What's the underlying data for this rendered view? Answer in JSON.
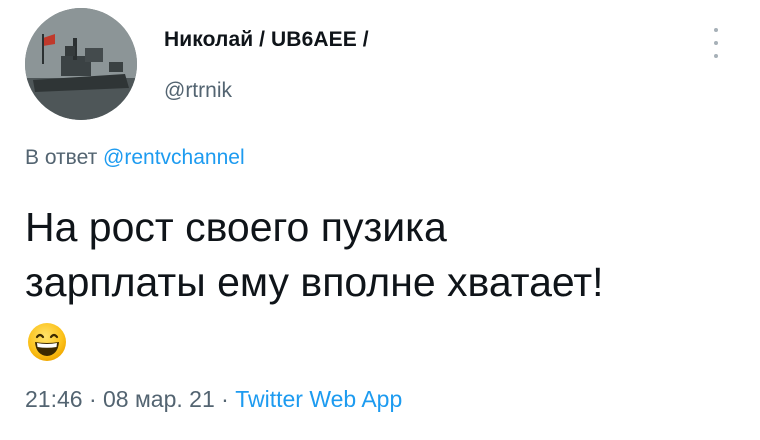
{
  "author": {
    "display_name": "Николай  / UB6AEE /",
    "handle": "@rtrnik"
  },
  "reply": {
    "prefix": "В ответ",
    "mention": "@rentvchannel"
  },
  "tweet": {
    "lines": [
      "На рост своего пузика",
      "зарплаты ему вполне хватает!"
    ],
    "emoji": "grinning-face-with-smiling-eyes"
  },
  "meta": {
    "time": "21:46",
    "date": "08 мар. 21",
    "separator": "·",
    "source": "Twitter Web App"
  },
  "colors": {
    "text": "#0f1419",
    "secondary": "#536471",
    "link": "#1d9bf0"
  }
}
